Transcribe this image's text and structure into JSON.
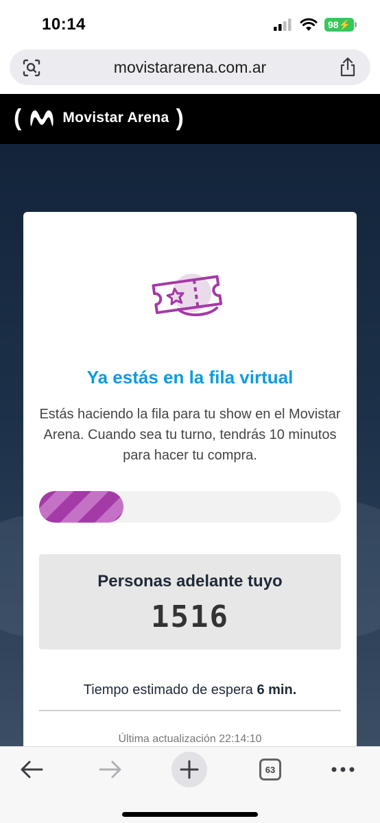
{
  "status_bar": {
    "time": "10:14",
    "battery": "98",
    "icons": [
      "cellular-signal-icon",
      "wifi-icon",
      "battery-charging-icon"
    ]
  },
  "browser": {
    "url": "movistararena.com.ar",
    "lens_icon": "visual-search-icon",
    "share_icon": "share-icon"
  },
  "site": {
    "brand": "Movistar Arena",
    "header_bg": "#000000"
  },
  "queue": {
    "title": "Ya estás en la fila virtual",
    "description": "Estás haciendo la fila para tu show en el Movistar Arena. Cuando sea tu turno, tendrás 10 minutos para hacer tu compra.",
    "progress_fraction": 0.28,
    "ahead_label": "Personas adelante tuyo",
    "ahead_count": "1516",
    "wait_prefix": "Tiempo estimado de espera",
    "wait_value": "6 min.",
    "last_update": "Última actualización 22:14:10",
    "accent_color": "#0b9be3",
    "progress_color": "#a43aa6"
  },
  "toolbar": {
    "tabs_count": "63",
    "icons": [
      "back-arrow-icon",
      "forward-arrow-icon",
      "new-tab-icon",
      "tabs-icon",
      "more-icon"
    ]
  }
}
